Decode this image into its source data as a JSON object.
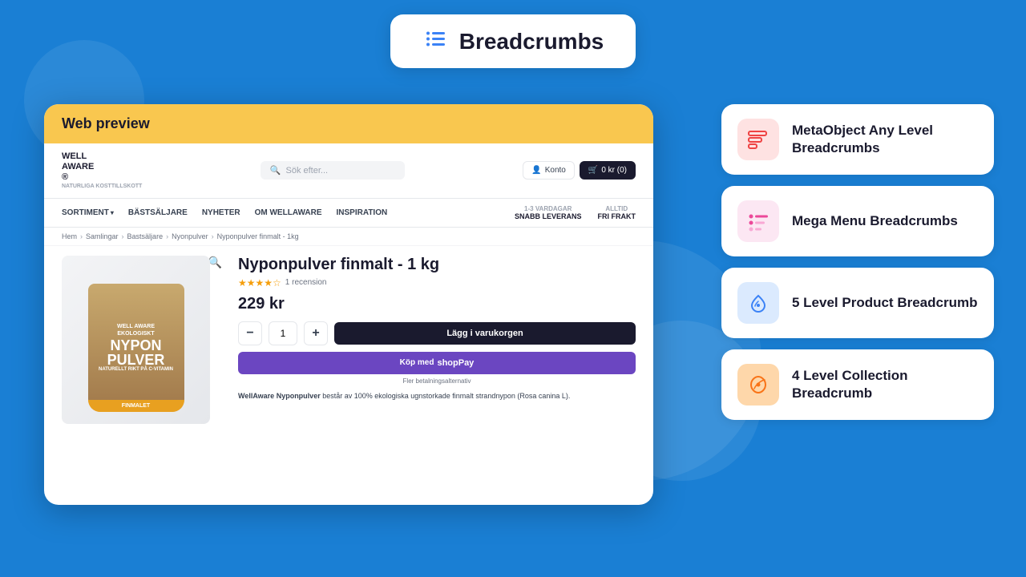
{
  "header": {
    "title": "Breadcrumbs",
    "icon_label": "list-icon"
  },
  "web_preview": {
    "label": "Web preview",
    "store": {
      "logo_line1": "WELL",
      "logo_line2": "AWARE",
      "logo_suffix": "®",
      "search_placeholder": "Sök efter...",
      "konto_label": "Konto",
      "cart_label": "0 kr (0)",
      "nav_items": [
        "SORTIMENT",
        "BÄSTSÄLJARE",
        "NYHETER",
        "OM WELLAWARE",
        "INSPIRATION"
      ],
      "delivery_label": "1-3 VARDAGAR",
      "delivery_value": "SNABB LEVERANS",
      "free_shipping_label": "ALLTID",
      "free_shipping_value": "FRI FRAKT",
      "breadcrumb": [
        "Hem",
        "Samlingar",
        "Bastsäljare",
        "Nyonpulver",
        "Nyponpulver finmalt - 1kg"
      ],
      "product_name": "Nyponpulver finmalt - 1 kg",
      "review_count": "1 recension",
      "price": "229 kr",
      "qty_value": "1",
      "add_to_cart": "Lägg i varukorgen",
      "buy_now": "Köp med",
      "payment_options": "Fler betalningsalternativ",
      "bag_brand": "WELL AWARE",
      "bag_line1": "EKOLOGISKT",
      "bag_main1": "NYPON",
      "bag_main2": "PULVER",
      "bag_footer": "FINMALET",
      "description_bold": "WellAware Nyponpulver",
      "description": " består av 100% ekologiska ugnstorkade finmalt strandnypon (Rosa canina L)."
    }
  },
  "right_panel": {
    "cards": [
      {
        "id": "metaobject",
        "icon_color": "red",
        "icon_label": "metaobject-icon",
        "title": "MetaObject Any Level Breadcrumbs"
      },
      {
        "id": "mega-menu",
        "icon_color": "pink",
        "icon_label": "mega-menu-icon",
        "title": "Mega Menu Breadcrumbs"
      },
      {
        "id": "product-breadcrumb",
        "icon_color": "blue",
        "icon_label": "product-breadcrumb-icon",
        "title": "5 Level Product Breadcrumb"
      },
      {
        "id": "collection-breadcrumb",
        "icon_color": "orange",
        "icon_label": "collection-breadcrumb-icon",
        "title": "4 Level Collection Breadcrumb"
      }
    ]
  }
}
